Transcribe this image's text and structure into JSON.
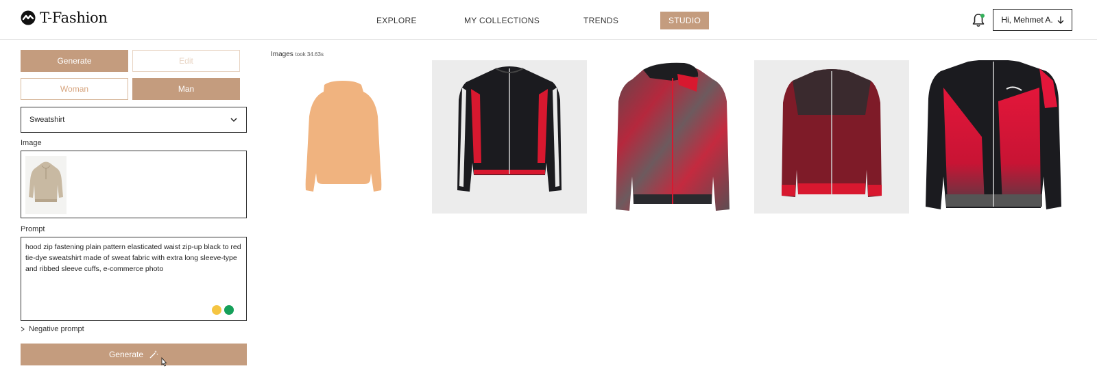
{
  "app": {
    "brand": "T-Fashion"
  },
  "nav": {
    "items": [
      {
        "label": "EXPLORE",
        "active": false
      },
      {
        "label": "MY COLLECTIONS",
        "active": false
      },
      {
        "label": "TRENDS",
        "active": false
      },
      {
        "label": "STUDIO",
        "active": true
      }
    ]
  },
  "user": {
    "greeting": "Hi, Mehmet A."
  },
  "sidebar": {
    "mode_tabs": {
      "generate": "Generate",
      "edit": "Edit"
    },
    "gender_tabs": {
      "woman": "Woman",
      "man": "Man",
      "selected": "Man"
    },
    "category_select": {
      "value": "Sweatshirt"
    },
    "image_label": "Image",
    "prompt_label": "Prompt",
    "prompt_value": "hood zip fastening plain pattern elasticated waist zip-up black to red tie-dye sweatshirt made of sweat fabric with extra long sleeve-type and ribbed sleeve cuffs, e-commerce photo",
    "negative_prompt_label": "Negative prompt",
    "generate_button": "Generate"
  },
  "results": {
    "label": "Images",
    "timing": "took 34.63s",
    "cards": [
      {
        "name": "sketch-silhouette"
      },
      {
        "name": "black-red-track-jacket"
      },
      {
        "name": "red-tiedye-hoodie"
      },
      {
        "name": "red-textured-jacket"
      },
      {
        "name": "black-red-geometric-jacket"
      }
    ]
  },
  "colors": {
    "accent": "#c49c7e",
    "silhouette": "#f0b37f",
    "jacket_red": "#d8182f",
    "jacket_black": "#1b1b1f"
  }
}
